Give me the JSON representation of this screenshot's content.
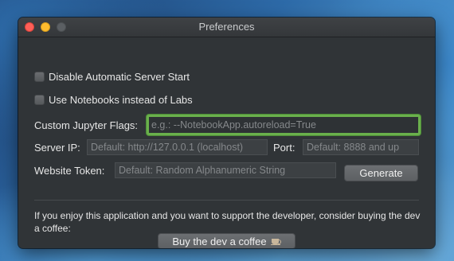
{
  "window": {
    "title": "Preferences"
  },
  "options": {
    "disable_autostart_label": "Disable Automatic Server Start",
    "use_notebooks_label": "Use Notebooks instead of Labs"
  },
  "jupyter_flags": {
    "label": "Custom Jupyter Flags:",
    "value": "",
    "placeholder": "e.g.: --NotebookApp.autoreload=True"
  },
  "server": {
    "ip_label": "Server IP:",
    "ip_placeholder": "Default: http://127.0.0.1 (localhost)",
    "port_label": "Port:",
    "port_placeholder": "Default: 8888 and up"
  },
  "token": {
    "label": "Website Token:",
    "placeholder": "Default: Random Alphanumeric String",
    "generate_label": "Generate"
  },
  "support": {
    "text": "If you enjoy this application and you want to support the developer, consider buying the dev a coffee:",
    "button_label": "Buy the dev a coffee",
    "button_icon": "coffee-icon"
  },
  "colors": {
    "focus_ring": "#6ab04c",
    "close": "#fe5f57",
    "minimize": "#febc2e",
    "maximize": "#5b5f63"
  }
}
